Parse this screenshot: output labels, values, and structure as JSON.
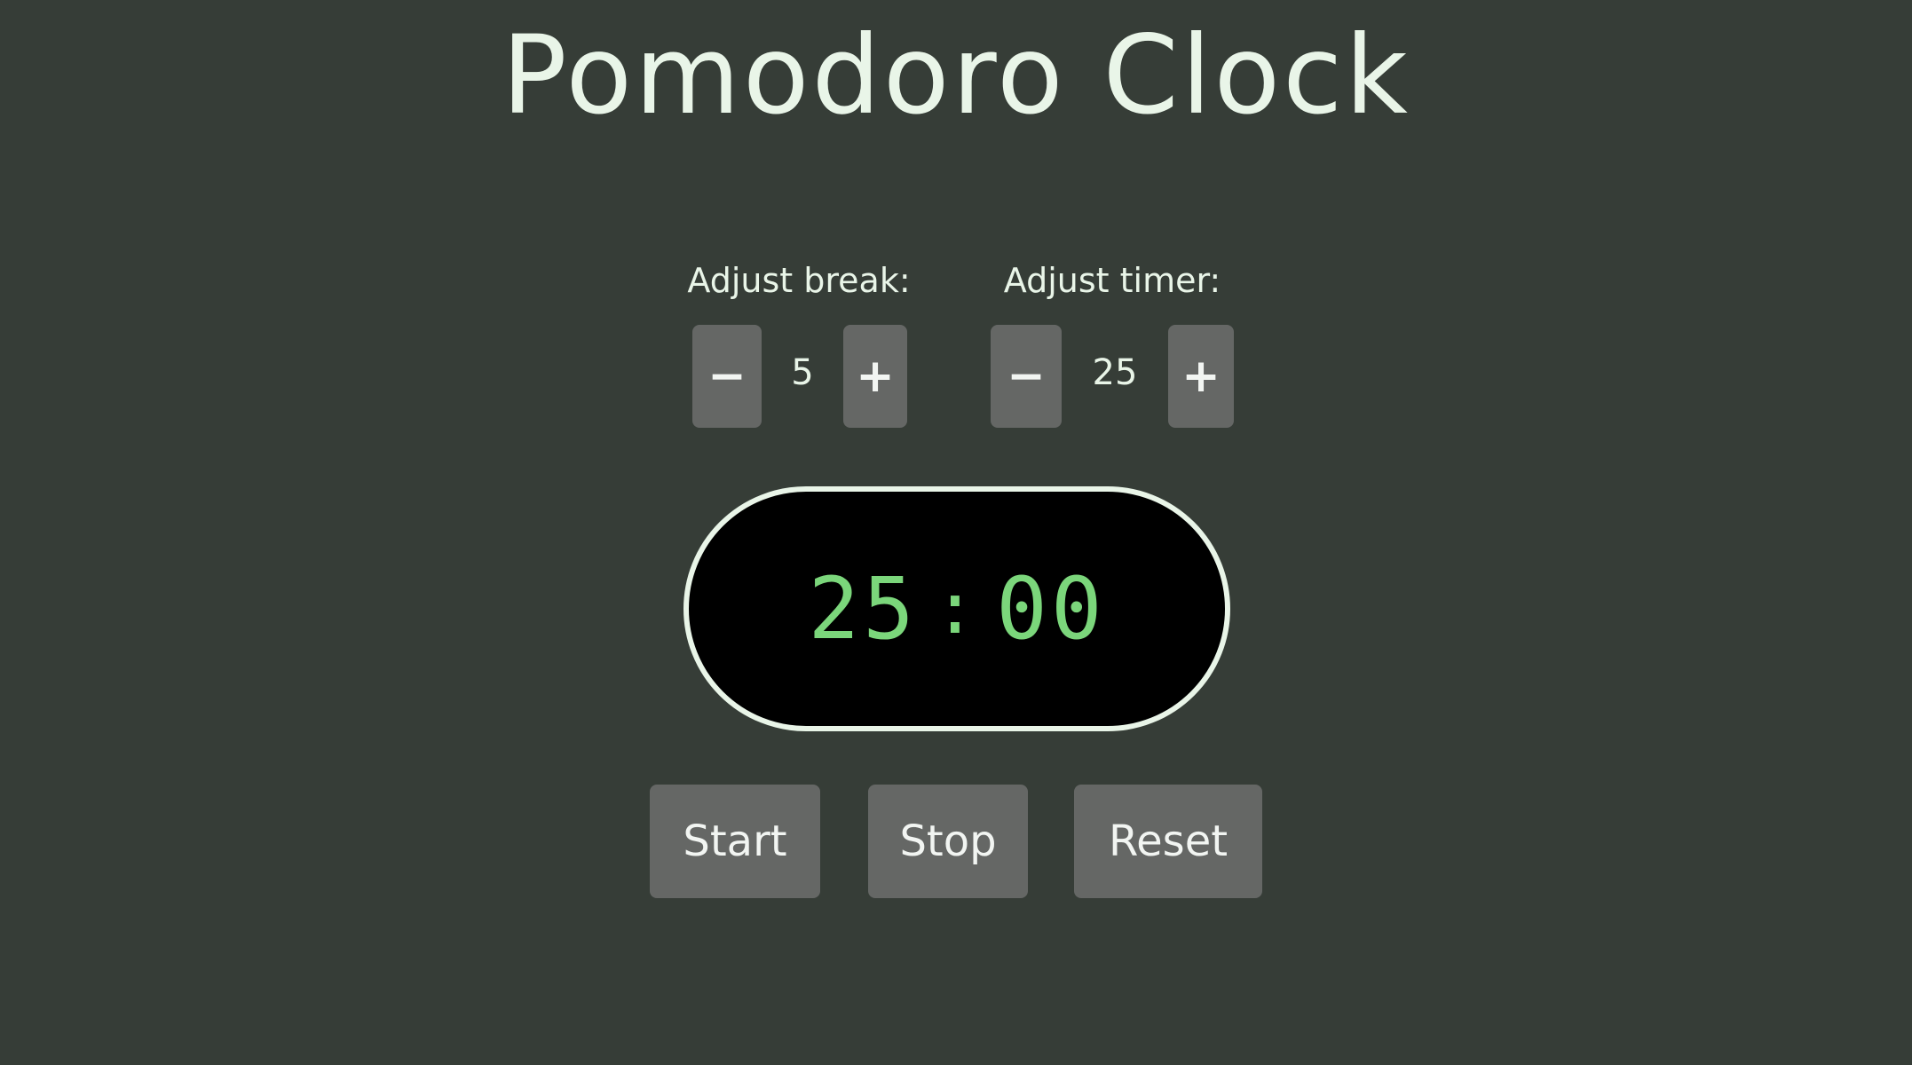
{
  "app": {
    "title": "Pomodoro Clock"
  },
  "break": {
    "label": "Adjust break:",
    "decrement": "−",
    "value": "5",
    "increment": "+"
  },
  "timer": {
    "label": "Adjust timer:",
    "decrement": "−",
    "value": "25",
    "increment": "+"
  },
  "display": {
    "minutes": "25",
    "separator": ":",
    "seconds": "00"
  },
  "controls": {
    "start": "Start",
    "stop": "Stop",
    "reset": "Reset"
  },
  "colors": {
    "background": "#363d37",
    "button": "#656765",
    "display_bg": "#000000",
    "digits": "#7bd67b",
    "text": "#e9f5e8"
  }
}
